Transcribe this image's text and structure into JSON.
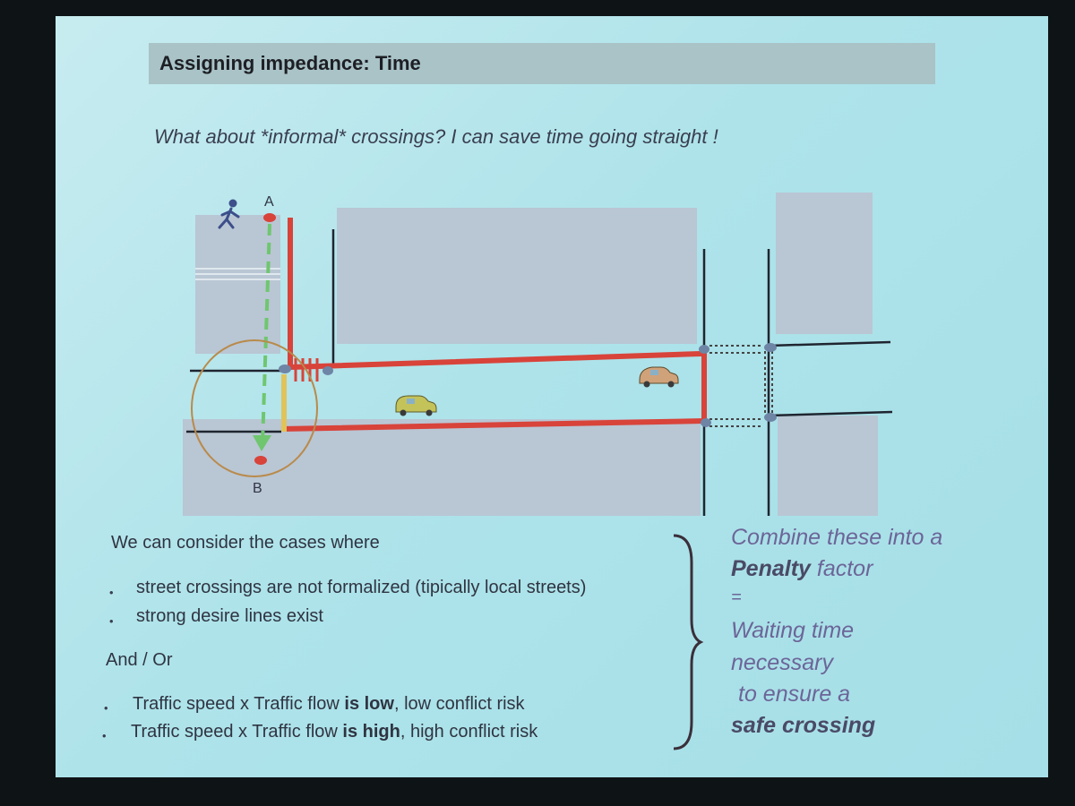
{
  "slide": {
    "title": "Assigning impedance: Time",
    "subtitle": "What about *informal* crossings? I can save time going straight !",
    "diagram": {
      "point_a": "A",
      "point_b": "B",
      "pedestrian_icon": "pedestrian-icon",
      "car_icon": "car-icon",
      "colors": {
        "route": "#d8433a",
        "shortcut": "#6fc66f",
        "highlight_circle": "#b98a4a",
        "block": "#b9c6d4",
        "street_line": "#1f2530"
      }
    },
    "left_panel": {
      "intro": "We can consider the cases where",
      "bullets": [
        "street crossings are not formalized (tipically local streets)",
        "strong desire lines exist"
      ],
      "connector": "And / Or",
      "traffic_bullets": [
        {
          "pre": "Traffic speed x Traffic flow ",
          "bold": "is low",
          "post": ", low conflict risk"
        },
        {
          "pre": "Traffic speed x Traffic flow ",
          "bold": "is high",
          "post": ", high conflict risk"
        }
      ],
      "bullet_symbol": "•"
    },
    "right_panel": {
      "line1": "Combine these into a",
      "line2_bold": "Penalty",
      "line2_rest": " factor",
      "equals": "=",
      "line3": "Waiting time",
      "line4": "necessary",
      "line5": "to ensure a",
      "line6_bold": "safe crossing"
    }
  }
}
